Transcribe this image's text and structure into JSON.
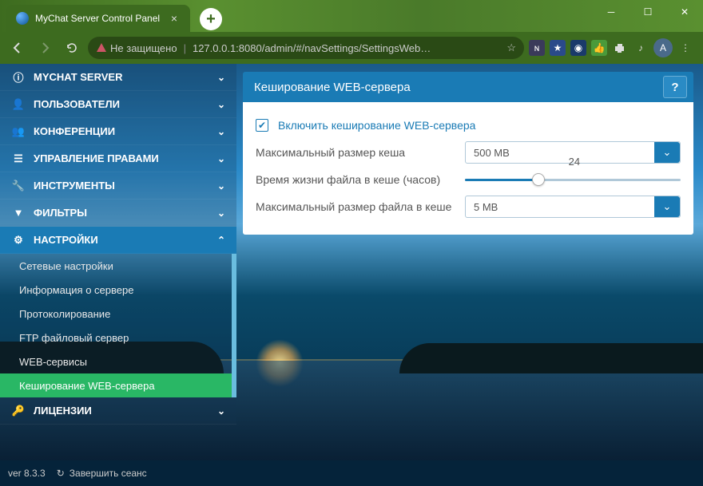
{
  "browser": {
    "tab_title": "MyChat Server Control Panel",
    "insecure_label": "Не защищено",
    "url": "127.0.0.1:8080/admin/#/navSettings/SettingsWeb…",
    "avatar_letter": "A"
  },
  "sidebar": {
    "items": [
      {
        "label": "MYCHAT SERVER",
        "icon": "info"
      },
      {
        "label": "ПОЛЬЗОВАТЕЛИ",
        "icon": "user"
      },
      {
        "label": "КОНФЕРЕНЦИИ",
        "icon": "users"
      },
      {
        "label": "УПРАВЛЕНИЕ ПРАВАМИ",
        "icon": "list"
      },
      {
        "label": "ИНСТРУМЕНТЫ",
        "icon": "wrench"
      },
      {
        "label": "ФИЛЬТРЫ",
        "icon": "filter"
      },
      {
        "label": "НАСТРОЙКИ",
        "icon": "gears"
      },
      {
        "label": "ЛИЦЕНЗИИ",
        "icon": "key"
      }
    ],
    "sub": [
      "Сетевые настройки",
      "Информация о сервере",
      "Протоколирование",
      "FTP файловый сервер",
      "WEB-сервисы",
      "Кеширование WEB-сервера"
    ]
  },
  "panel": {
    "title": "Кеширование WEB-сервера",
    "enable_label": "Включить кеширование WEB-сервера",
    "max_cache_label": "Максимальный размер кеша",
    "max_cache_value": "500 MB",
    "ttl_label": "Время жизни файла в кеше (часов)",
    "ttl_value": "24",
    "max_file_label": "Максимальный размер файла в кеше",
    "max_file_value": "5 MB"
  },
  "footer": {
    "version": "ver 8.3.3",
    "logout": "Завершить сеанс"
  }
}
